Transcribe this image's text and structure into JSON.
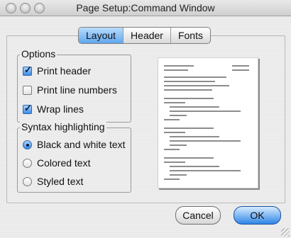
{
  "window": {
    "title": "Page Setup:Command Window"
  },
  "tabs": [
    {
      "label": "Layout"
    },
    {
      "label": "Header"
    },
    {
      "label": "Fonts"
    }
  ],
  "options": {
    "legend": "Options",
    "print_header_label": "Print header",
    "print_header_checked": true,
    "print_line_numbers_label": "Print line numbers",
    "print_line_numbers_checked": false,
    "wrap_lines_label": "Wrap lines",
    "wrap_lines_checked": true
  },
  "syntax_highlighting": {
    "legend": "Syntax highlighting",
    "bw_label": "Black and white text",
    "colored_label": "Colored text",
    "styled_label": "Styled text",
    "selected": "Black and white text"
  },
  "buttons": {
    "cancel": "Cancel",
    "ok": "OK"
  }
}
